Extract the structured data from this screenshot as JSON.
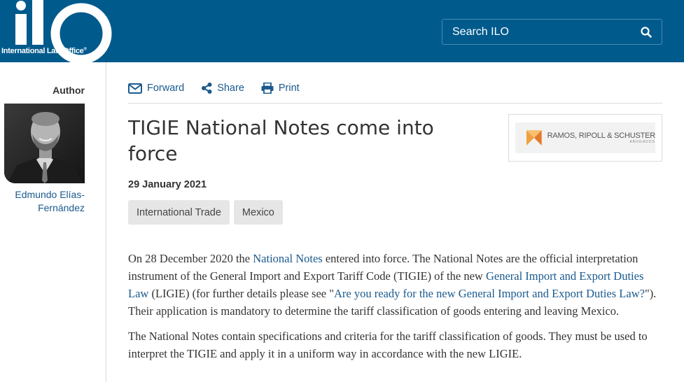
{
  "header": {
    "logo_text": "International Law Office",
    "logo_mark": "ilo",
    "search_placeholder": "Search ILO",
    "brand_color": "#005a8c"
  },
  "sidebar": {
    "author_label": "Author",
    "author_name": "Edmundo Elías-Fernández"
  },
  "article": {
    "actions": {
      "forward": "Forward",
      "share": "Share",
      "print": "Print"
    },
    "title": "TIGIE National Notes come into force",
    "date": "29 January 2021",
    "tags": [
      "International Trade",
      "Mexico"
    ],
    "firm_logo_text": "RAMOS, RIPOLL & SCHUSTER",
    "firm_logo_subtext": "ABOGADOS",
    "p1": {
      "t1": "On 28 December 2020 the ",
      "l1": "National Notes",
      "t2": " entered into force. The National Notes are the official interpretation instrument of the General Import and Export Tariff Code (TIGIE) of the new ",
      "l2": "General Import and Export Duties Law",
      "t3": " (LIGIE) (for further details please see \"",
      "l3": "Are you ready for the new General Import and Export Duties Law?",
      "t4": "\"). Their application is mandatory to determine the tariff classification of goods entering and leaving Mexico."
    },
    "p2": "The National Notes contain specifications and criteria for the tariff classification of goods. They must be used to interpret the TIGIE and apply it in a uniform way in accordance with the new LIGIE."
  },
  "colors": {
    "link": "#1a5a8e",
    "tag_bg": "#e6e6e6",
    "firm_accent": "#f0a040"
  }
}
